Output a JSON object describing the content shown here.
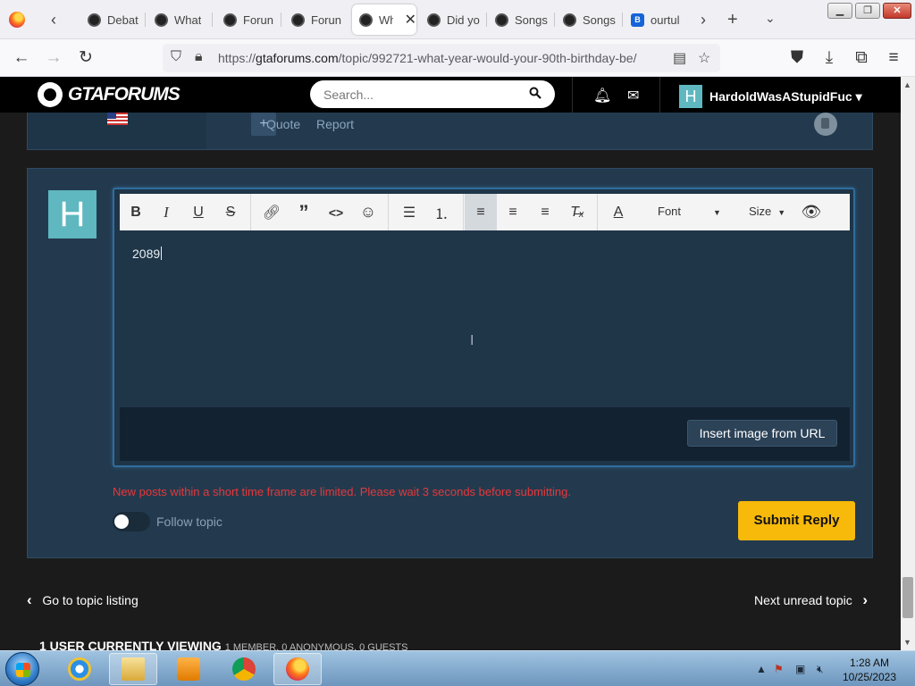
{
  "browser": {
    "tabs": [
      {
        "title": "Debat",
        "active": false
      },
      {
        "title": "What",
        "active": false
      },
      {
        "title": "Forun",
        "active": false
      },
      {
        "title": "Forun",
        "active": false
      },
      {
        "title": "Wh",
        "active": true
      },
      {
        "title": "Did yo",
        "active": false
      },
      {
        "title": "Songs",
        "active": false
      },
      {
        "title": "Songs",
        "active": false
      },
      {
        "title": "ourtul",
        "active": false
      }
    ],
    "url_prefix": "https://",
    "url_host": "gtaforums.com",
    "url_path": "/topic/992721-what-year-would-your-90th-birthday-be/"
  },
  "site": {
    "logo_text": "GTAFORUMS",
    "search_placeholder": "Search...",
    "user_initial": "H",
    "username": "HardoldWasAStupidFuc",
    "accent_color": "#f7b90a",
    "avatar_color": "#5fb7c0"
  },
  "previous_post": {
    "quote_label": "Quote",
    "report_label": "Report",
    "plus_label": "+"
  },
  "reply": {
    "avatar_initial": "H",
    "toolbar": {
      "bold": "B",
      "italic": "I",
      "underline": "U",
      "strike": "S",
      "font_label": "Font",
      "size_label": "Size"
    },
    "editor_text": "2089",
    "insert_image_label": "Insert image from URL",
    "warning": "New posts within a short time frame are limited. Please wait 3 seconds before submitting.",
    "follow_label": "Follow topic",
    "submit_label": "Submit Reply"
  },
  "bottom_nav": {
    "prev_label": "Go to topic listing",
    "next_label": "Next unread topic"
  },
  "viewing": {
    "title": "1 USER CURRENTLY VIEWING",
    "detail": "1 MEMBER, 0 ANONYMOUS, 0 GUESTS"
  },
  "taskbar": {
    "time": "1:28 AM",
    "date": "10/25/2023"
  }
}
